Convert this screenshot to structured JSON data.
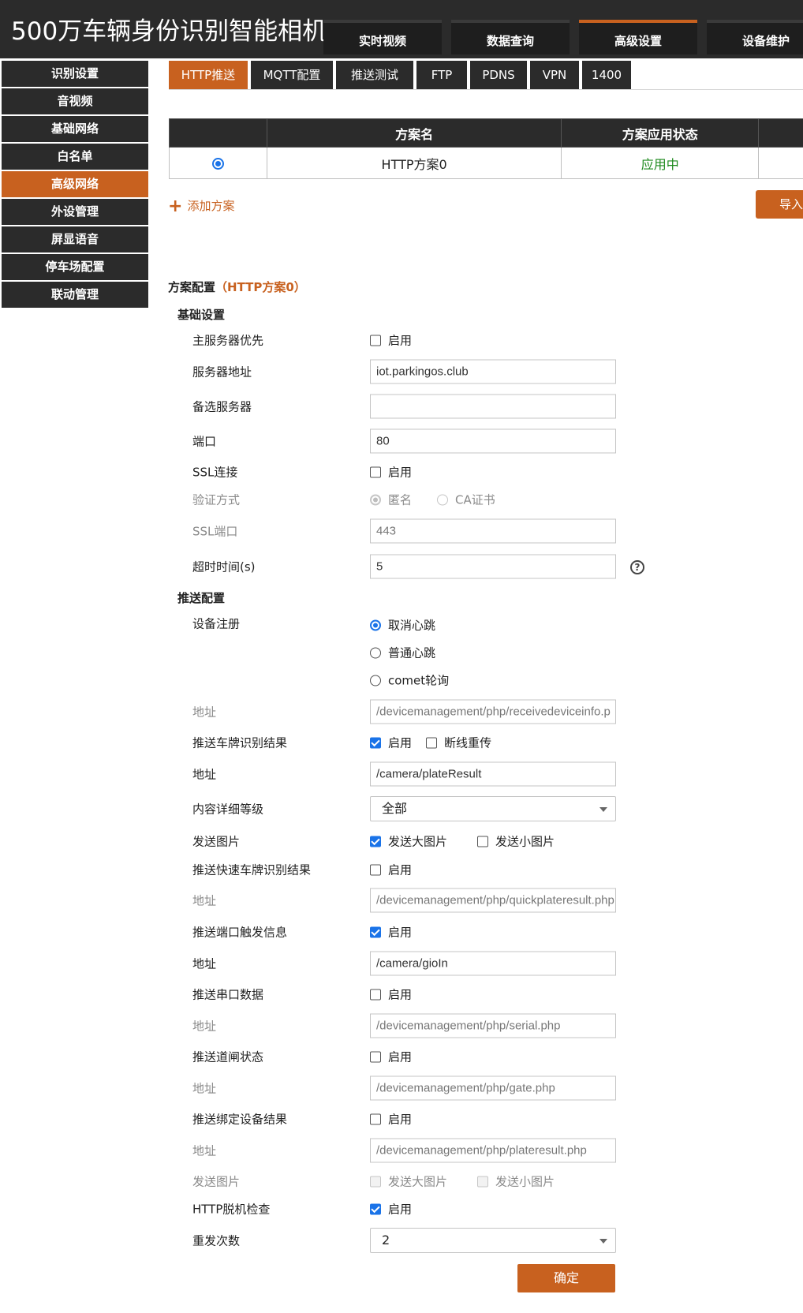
{
  "app": {
    "title": "500万车辆身份识别智能相机"
  },
  "top_nav": [
    {
      "label": "实时视频"
    },
    {
      "label": "数据查询"
    },
    {
      "label": "高级设置"
    },
    {
      "label": "设备维护"
    }
  ],
  "sidebar": [
    {
      "label": "识别设置"
    },
    {
      "label": "音视频"
    },
    {
      "label": "基础网络"
    },
    {
      "label": "白名单"
    },
    {
      "label": "高级网络"
    },
    {
      "label": "外设管理"
    },
    {
      "label": "屏显语音"
    },
    {
      "label": "停车场配置"
    },
    {
      "label": "联动管理"
    }
  ],
  "sub_tabs": [
    {
      "label": "HTTP推送"
    },
    {
      "label": "MQTT配置"
    },
    {
      "label": "推送测试"
    },
    {
      "label": "FTP"
    },
    {
      "label": "PDNS"
    },
    {
      "label": "VPN"
    },
    {
      "label": "1400"
    }
  ],
  "scheme_table": {
    "headers": [
      "",
      "方案名",
      "方案应用状态"
    ],
    "rows": [
      {
        "name": "HTTP方案0",
        "status": "应用中",
        "selected": true
      }
    ]
  },
  "add_scheme": "添加方案",
  "import_label": "导入",
  "config_title": {
    "prefix": "方案配置",
    "scheme": "（HTTP方案0）"
  },
  "basic": {
    "title": "基础设置",
    "main_server_priority": {
      "label": "主服务器优先",
      "option": "启用",
      "checked": false
    },
    "server_address": {
      "label": "服务器地址",
      "value": "iot.parkingos.club"
    },
    "backup_server": {
      "label": "备选服务器",
      "value": ""
    },
    "port": {
      "label": "端口",
      "value": "80"
    },
    "ssl": {
      "label": "SSL连接",
      "option": "启用",
      "checked": false
    },
    "auth": {
      "label": "验证方式",
      "options": [
        "匿名",
        "CA证书"
      ],
      "selected": "匿名"
    },
    "ssl_port": {
      "label": "SSL端口",
      "value": "443"
    },
    "timeout": {
      "label": "超时时间(s)",
      "value": "5",
      "help_icon": "?"
    }
  },
  "push": {
    "title": "推送配置",
    "device_register": {
      "label": "设备注册",
      "options": [
        "取消心跳",
        "普通心跳",
        "comet轮询"
      ],
      "selected": "取消心跳"
    },
    "register_address": {
      "label": "地址",
      "value": "/devicemanagement/php/receivedeviceinfo.p"
    },
    "plate_result": {
      "label": "推送车牌识别结果",
      "option": "启用",
      "checked": true,
      "option2": "断线重传",
      "checked2": false
    },
    "plate_address": {
      "label": "地址",
      "value": "/camera/plateResult"
    },
    "detail_level": {
      "label": "内容详细等级",
      "value": "全部"
    },
    "send_images": {
      "label": "发送图片",
      "option": "发送大图片",
      "checked": true,
      "option2": "发送小图片",
      "checked2": false
    },
    "quick_plate": {
      "label": "推送快速车牌识别结果",
      "option": "启用",
      "checked": false
    },
    "quick_address": {
      "label": "地址",
      "value": "/devicemanagement/php/quickplateresult.php"
    },
    "port_trigger": {
      "label": "推送端口触发信息",
      "option": "启用",
      "checked": true
    },
    "port_address": {
      "label": "地址",
      "value": "/camera/gioIn"
    },
    "serial_data": {
      "label": "推送串口数据",
      "option": "启用",
      "checked": false
    },
    "serial_address": {
      "label": "地址",
      "value": "/devicemanagement/php/serial.php"
    },
    "gate_status": {
      "label": "推送道闸状态",
      "option": "启用",
      "checked": false
    },
    "gate_address": {
      "label": "地址",
      "value": "/devicemanagement/php/gate.php"
    },
    "bind_result": {
      "label": "推送绑定设备结果",
      "option": "启用",
      "checked": false
    },
    "bind_address": {
      "label": "地址",
      "value": "/devicemanagement/php/plateresult.php"
    },
    "bind_images": {
      "label": "发送图片",
      "option": "发送大图片",
      "option2": "发送小图片"
    },
    "offline_check": {
      "label": "HTTP脱机检查",
      "option": "启用",
      "checked": true
    },
    "retry_count": {
      "label": "重发次数",
      "value": "2"
    }
  },
  "confirm_label": "确定",
  "colors": {
    "accent": "#c8611f",
    "dark": "#2b2b2b",
    "active_status": "#1e8a1e",
    "checkbox": "#1a73e8"
  }
}
